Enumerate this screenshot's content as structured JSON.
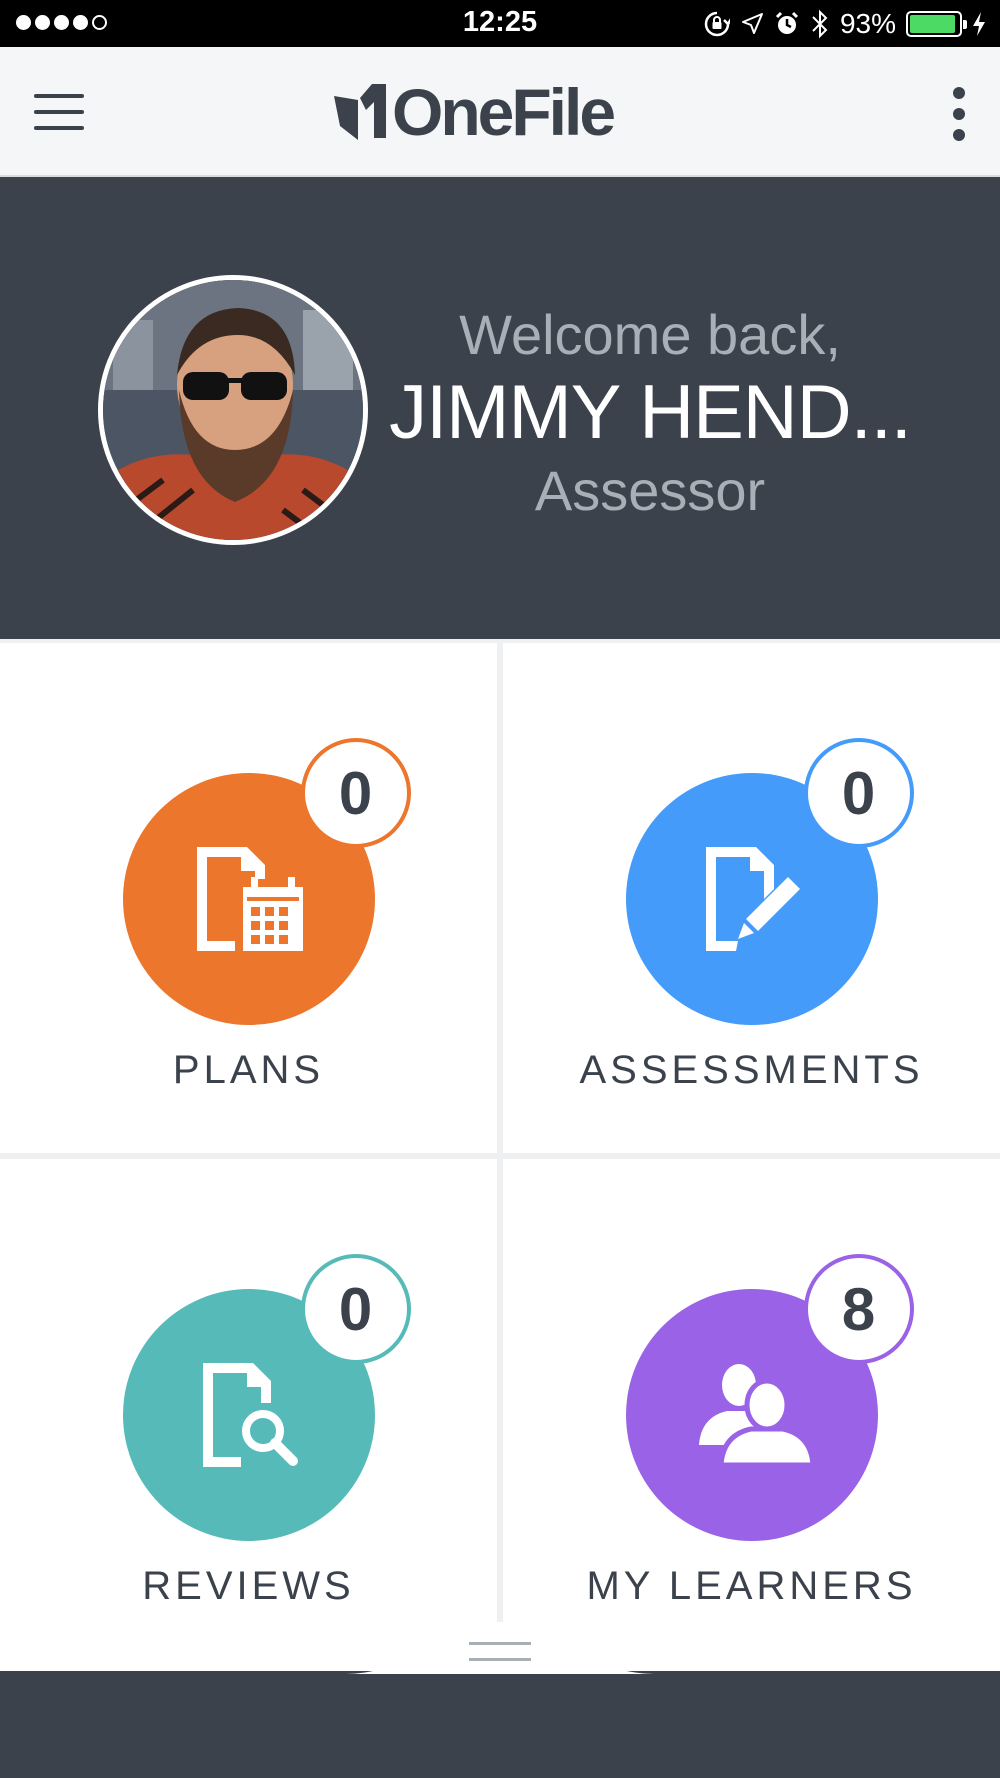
{
  "status_bar": {
    "time": "12:25",
    "battery": "93%",
    "battery_level": 0.93,
    "signal_bars": 4,
    "signal_max": 5
  },
  "app_bar": {
    "logo_text": "OneFile"
  },
  "hero": {
    "welcome": "Welcome back,",
    "name": "JIMMY HEND...",
    "role": "Assessor"
  },
  "tiles": [
    {
      "label": "PLANS",
      "count": "0",
      "color": "#ec762c",
      "icon": "plan-calendar-icon"
    },
    {
      "label": "ASSESSMENTS",
      "count": "0",
      "color": "#449bfa",
      "icon": "document-edit-icon"
    },
    {
      "label": "REVIEWS",
      "count": "0",
      "color": "#56bab9",
      "icon": "document-search-icon"
    },
    {
      "label": "MY LEARNERS",
      "count": "8",
      "color": "#9a62e6",
      "icon": "users-icon"
    }
  ],
  "colors": {
    "header_bg": "#3b424c",
    "appbar_bg": "#f5f6f7",
    "text_dark": "#3b424c",
    "text_muted": "#a9afb7"
  }
}
